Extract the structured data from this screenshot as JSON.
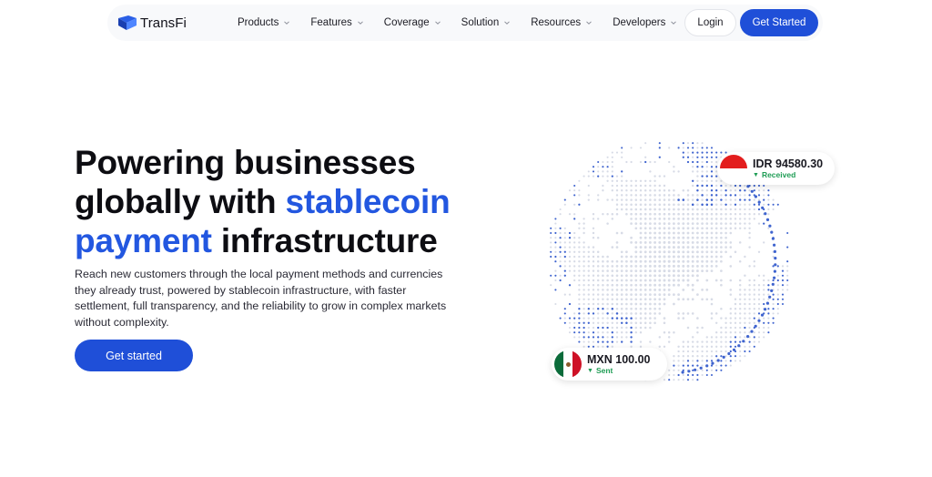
{
  "brand": {
    "name": "TransFi",
    "color": "#1f4fd8"
  },
  "nav": {
    "items": [
      {
        "label": "Products"
      },
      {
        "label": "Features"
      },
      {
        "label": "Coverage"
      },
      {
        "label": "Solution"
      },
      {
        "label": "Resources"
      },
      {
        "label": "Developers"
      }
    ],
    "login_label": "Login",
    "get_started_label": "Get Started"
  },
  "hero": {
    "headline_part1": "Powering businesses globally with ",
    "headline_highlight": "stablecoin payment",
    "headline_part2": " infrastructure",
    "subtext": "Reach new customers through the local payment methods and currencies they already trust, powered by stablecoin infrastructure, with faster settlement, full transparency, and the reliability to grow in complex markets without complexity.",
    "cta_label": "Get started"
  },
  "cards": {
    "idr": {
      "amount": "IDR 94580.30",
      "status": "Received",
      "status_icon": "arrow-down-icon"
    },
    "mxn": {
      "amount": "MXN 100.00",
      "status": "Sent",
      "status_icon": "arrow-up-icon"
    }
  },
  "colors": {
    "accent": "#2357e0",
    "success": "#1f9d55",
    "globe_dot": "#d7dbe6",
    "globe_dot_active": "#3f64cf"
  }
}
